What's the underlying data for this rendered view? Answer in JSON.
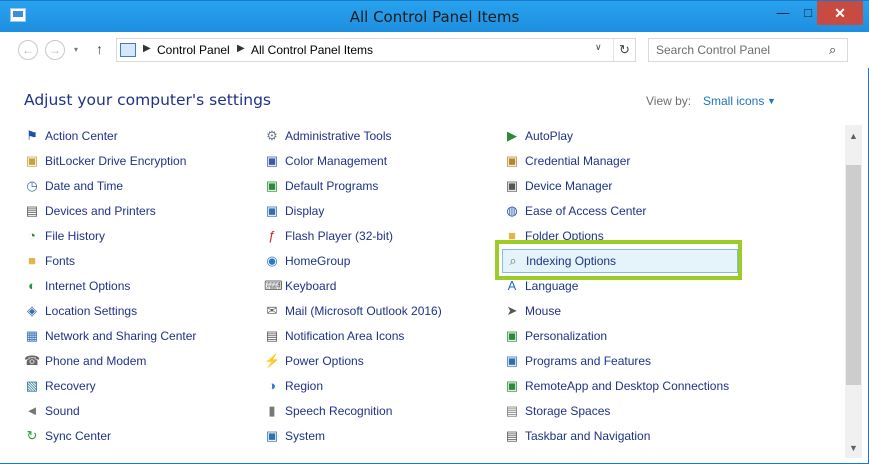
{
  "window": {
    "title": "All Control Panel Items"
  },
  "titlebar": {
    "minimize": "—",
    "maximize": "□",
    "close": "✕"
  },
  "nav": {
    "back": "←",
    "forward": "→",
    "recent": "▾",
    "up": "↑",
    "breadcrumb": [
      "Control Panel",
      "All Control Panel Items"
    ],
    "separator": "▶",
    "dropdown": "∨",
    "refresh": "↻",
    "search_placeholder": "Search Control Panel",
    "search_icon": "⌕"
  },
  "header": {
    "title": "Adjust your computer's settings",
    "view_by_label": "View by:",
    "view_by_value": "Small icons",
    "view_by_arrow": "▼"
  },
  "columns": [
    [
      {
        "label": "Action Center",
        "icon": "flag-icon",
        "glyph": "⚑",
        "color": "#1f4fa8"
      },
      {
        "label": "BitLocker Drive Encryption",
        "icon": "drive-lock-icon",
        "glyph": "▣",
        "color": "#c8a23a"
      },
      {
        "label": "Date and Time",
        "icon": "clock-icon",
        "glyph": "◷",
        "color": "#3a6ea8"
      },
      {
        "label": "Devices and Printers",
        "icon": "printer-icon",
        "glyph": "▤",
        "color": "#555"
      },
      {
        "label": "File History",
        "icon": "file-history-icon",
        "glyph": "◔",
        "color": "#2c8c3c"
      },
      {
        "label": "Fonts",
        "icon": "fonts-folder-icon",
        "glyph": "■",
        "color": "#e3b64a"
      },
      {
        "label": "Internet Options",
        "icon": "globe-icon",
        "glyph": "◐",
        "color": "#2a8a4a"
      },
      {
        "label": "Location Settings",
        "icon": "location-icon",
        "glyph": "◈",
        "color": "#3a6ea8"
      },
      {
        "label": "Network and Sharing Center",
        "icon": "network-icon",
        "glyph": "▦",
        "color": "#2f6fb4"
      },
      {
        "label": "Phone and Modem",
        "icon": "phone-icon",
        "glyph": "☎",
        "color": "#666"
      },
      {
        "label": "Recovery",
        "icon": "recovery-icon",
        "glyph": "▧",
        "color": "#2a7a9a"
      },
      {
        "label": "Sound",
        "icon": "speaker-icon",
        "glyph": "◄",
        "color": "#777"
      },
      {
        "label": "Sync Center",
        "icon": "sync-icon",
        "glyph": "↻",
        "color": "#2a9a3a"
      }
    ],
    [
      {
        "label": "Administrative Tools",
        "icon": "admin-tools-icon",
        "glyph": "⚙",
        "color": "#6a7a8a"
      },
      {
        "label": "Color Management",
        "icon": "color-management-icon",
        "glyph": "▣",
        "color": "#3a5aa8"
      },
      {
        "label": "Default Programs",
        "icon": "default-programs-icon",
        "glyph": "▣",
        "color": "#2a8a3a"
      },
      {
        "label": "Display",
        "icon": "display-icon",
        "glyph": "▣",
        "color": "#2f6fb4"
      },
      {
        "label": "Flash Player (32-bit)",
        "icon": "flash-icon",
        "glyph": "ƒ",
        "color": "#c62828"
      },
      {
        "label": "HomeGroup",
        "icon": "homegroup-icon",
        "glyph": "◉",
        "color": "#2a7ac8"
      },
      {
        "label": "Keyboard",
        "icon": "keyboard-icon",
        "glyph": "⌨",
        "color": "#666"
      },
      {
        "label": "Mail (Microsoft Outlook 2016)",
        "icon": "mail-icon",
        "glyph": "✉",
        "color": "#555"
      },
      {
        "label": "Notification Area Icons",
        "icon": "notification-icon",
        "glyph": "▤",
        "color": "#555"
      },
      {
        "label": "Power Options",
        "icon": "power-icon",
        "glyph": "⚡",
        "color": "#2a8a3a"
      },
      {
        "label": "Region",
        "icon": "region-icon",
        "glyph": "◑",
        "color": "#2a7ac8"
      },
      {
        "label": "Speech Recognition",
        "icon": "microphone-icon",
        "glyph": "▮",
        "color": "#777"
      },
      {
        "label": "System",
        "icon": "system-icon",
        "glyph": "▣",
        "color": "#2f6fb4"
      }
    ],
    [
      {
        "label": "AutoPlay",
        "icon": "autoplay-icon",
        "glyph": "▶",
        "color": "#2a8a3a"
      },
      {
        "label": "Credential Manager",
        "icon": "credential-icon",
        "glyph": "▣",
        "color": "#b8862a"
      },
      {
        "label": "Device Manager",
        "icon": "device-manager-icon",
        "glyph": "▣",
        "color": "#555"
      },
      {
        "label": "Ease of Access Center",
        "icon": "ease-of-access-icon",
        "glyph": "◍",
        "color": "#1f4fa8"
      },
      {
        "label": "Folder Options",
        "icon": "folder-icon",
        "glyph": "■",
        "color": "#e3b64a"
      },
      {
        "label": "Indexing Options",
        "icon": "indexing-icon",
        "glyph": "⌕",
        "color": "#6a7a8a",
        "selected": true
      },
      {
        "label": "Language",
        "icon": "language-icon",
        "glyph": "A",
        "color": "#2a6ac8"
      },
      {
        "label": "Mouse",
        "icon": "mouse-icon",
        "glyph": "➤",
        "color": "#555"
      },
      {
        "label": "Personalization",
        "icon": "personalization-icon",
        "glyph": "▣",
        "color": "#2a8a3a"
      },
      {
        "label": "Programs and Features",
        "icon": "programs-icon",
        "glyph": "▣",
        "color": "#2f6fb4"
      },
      {
        "label": "RemoteApp and Desktop Connections",
        "icon": "remoteapp-icon",
        "glyph": "▣",
        "color": "#2a8a3a"
      },
      {
        "label": "Storage Spaces",
        "icon": "storage-icon",
        "glyph": "▤",
        "color": "#777"
      },
      {
        "label": "Taskbar and Navigation",
        "icon": "taskbar-icon",
        "glyph": "▤",
        "color": "#555"
      }
    ]
  ],
  "scrollbar": {
    "up": "▲",
    "down": "▼"
  }
}
